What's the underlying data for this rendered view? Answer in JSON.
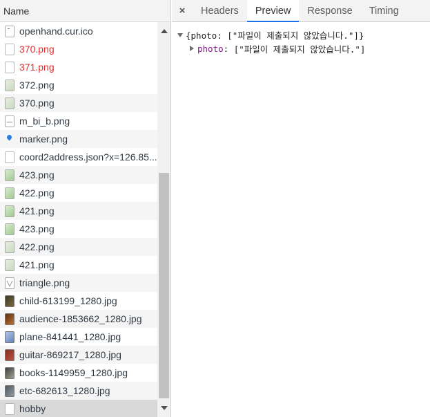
{
  "list": {
    "header": "Name",
    "rows": [
      {
        "name": "openhand.cur.ico",
        "icon": "file-cursor-icon",
        "status": "normal"
      },
      {
        "name": "370.png",
        "icon": "file-blank-icon",
        "status": "error"
      },
      {
        "name": "371.png",
        "icon": "file-blank-icon",
        "status": "error"
      },
      {
        "name": "372.png",
        "icon": "image-thumbnail-icon",
        "status": "normal"
      },
      {
        "name": "370.png",
        "icon": "image-thumbnail-icon",
        "status": "normal"
      },
      {
        "name": "m_bi_b.png",
        "icon": "image-thumbnail-icon",
        "status": "normal"
      },
      {
        "name": "marker.png",
        "icon": "map-marker-icon",
        "status": "normal"
      },
      {
        "name": "coord2address.json?x=126.85...",
        "icon": "file-blank-icon",
        "status": "normal"
      },
      {
        "name": "423.png",
        "icon": "image-thumbnail-icon",
        "status": "normal"
      },
      {
        "name": "422.png",
        "icon": "image-thumbnail-icon",
        "status": "normal"
      },
      {
        "name": "421.png",
        "icon": "image-thumbnail-icon",
        "status": "normal"
      },
      {
        "name": "423.png",
        "icon": "image-thumbnail-icon",
        "status": "normal"
      },
      {
        "name": "422.png",
        "icon": "image-thumbnail-icon",
        "status": "normal"
      },
      {
        "name": "421.png",
        "icon": "image-thumbnail-icon",
        "status": "normal"
      },
      {
        "name": "triangle.png",
        "icon": "triangle-image-icon",
        "status": "normal"
      },
      {
        "name": "child-613199_1280.jpg",
        "icon": "photo-thumbnail-icon",
        "status": "normal"
      },
      {
        "name": "audience-1853662_1280.jpg",
        "icon": "photo-thumbnail-icon",
        "status": "normal"
      },
      {
        "name": "plane-841441_1280.jpg",
        "icon": "photo-thumbnail-icon",
        "status": "normal"
      },
      {
        "name": "guitar-869217_1280.jpg",
        "icon": "photo-thumbnail-icon",
        "status": "normal"
      },
      {
        "name": "books-1149959_1280.jpg",
        "icon": "photo-thumbnail-icon",
        "status": "normal"
      },
      {
        "name": "etc-682613_1280.jpg",
        "icon": "photo-thumbnail-icon",
        "status": "normal"
      },
      {
        "name": "hobby",
        "icon": "file-blank-icon",
        "status": "selected"
      }
    ]
  },
  "detail": {
    "close_label": "×",
    "tabs": [
      {
        "label": "Headers",
        "active": false
      },
      {
        "label": "Preview",
        "active": true
      },
      {
        "label": "Response",
        "active": false
      },
      {
        "label": "Timing",
        "active": false
      }
    ],
    "preview": {
      "root_summary": "{photo: [\"파일이 제출되지 않았습니다.\"]}",
      "child_key": "photo",
      "child_value": "[\"파일이 제출되지 않았습니다.\"]"
    }
  },
  "colors": {
    "error_text": "#e12d2d",
    "active_tab_underline": "#1a73e8",
    "selected_row": "#d9d9d9",
    "json_key": "#881391"
  }
}
